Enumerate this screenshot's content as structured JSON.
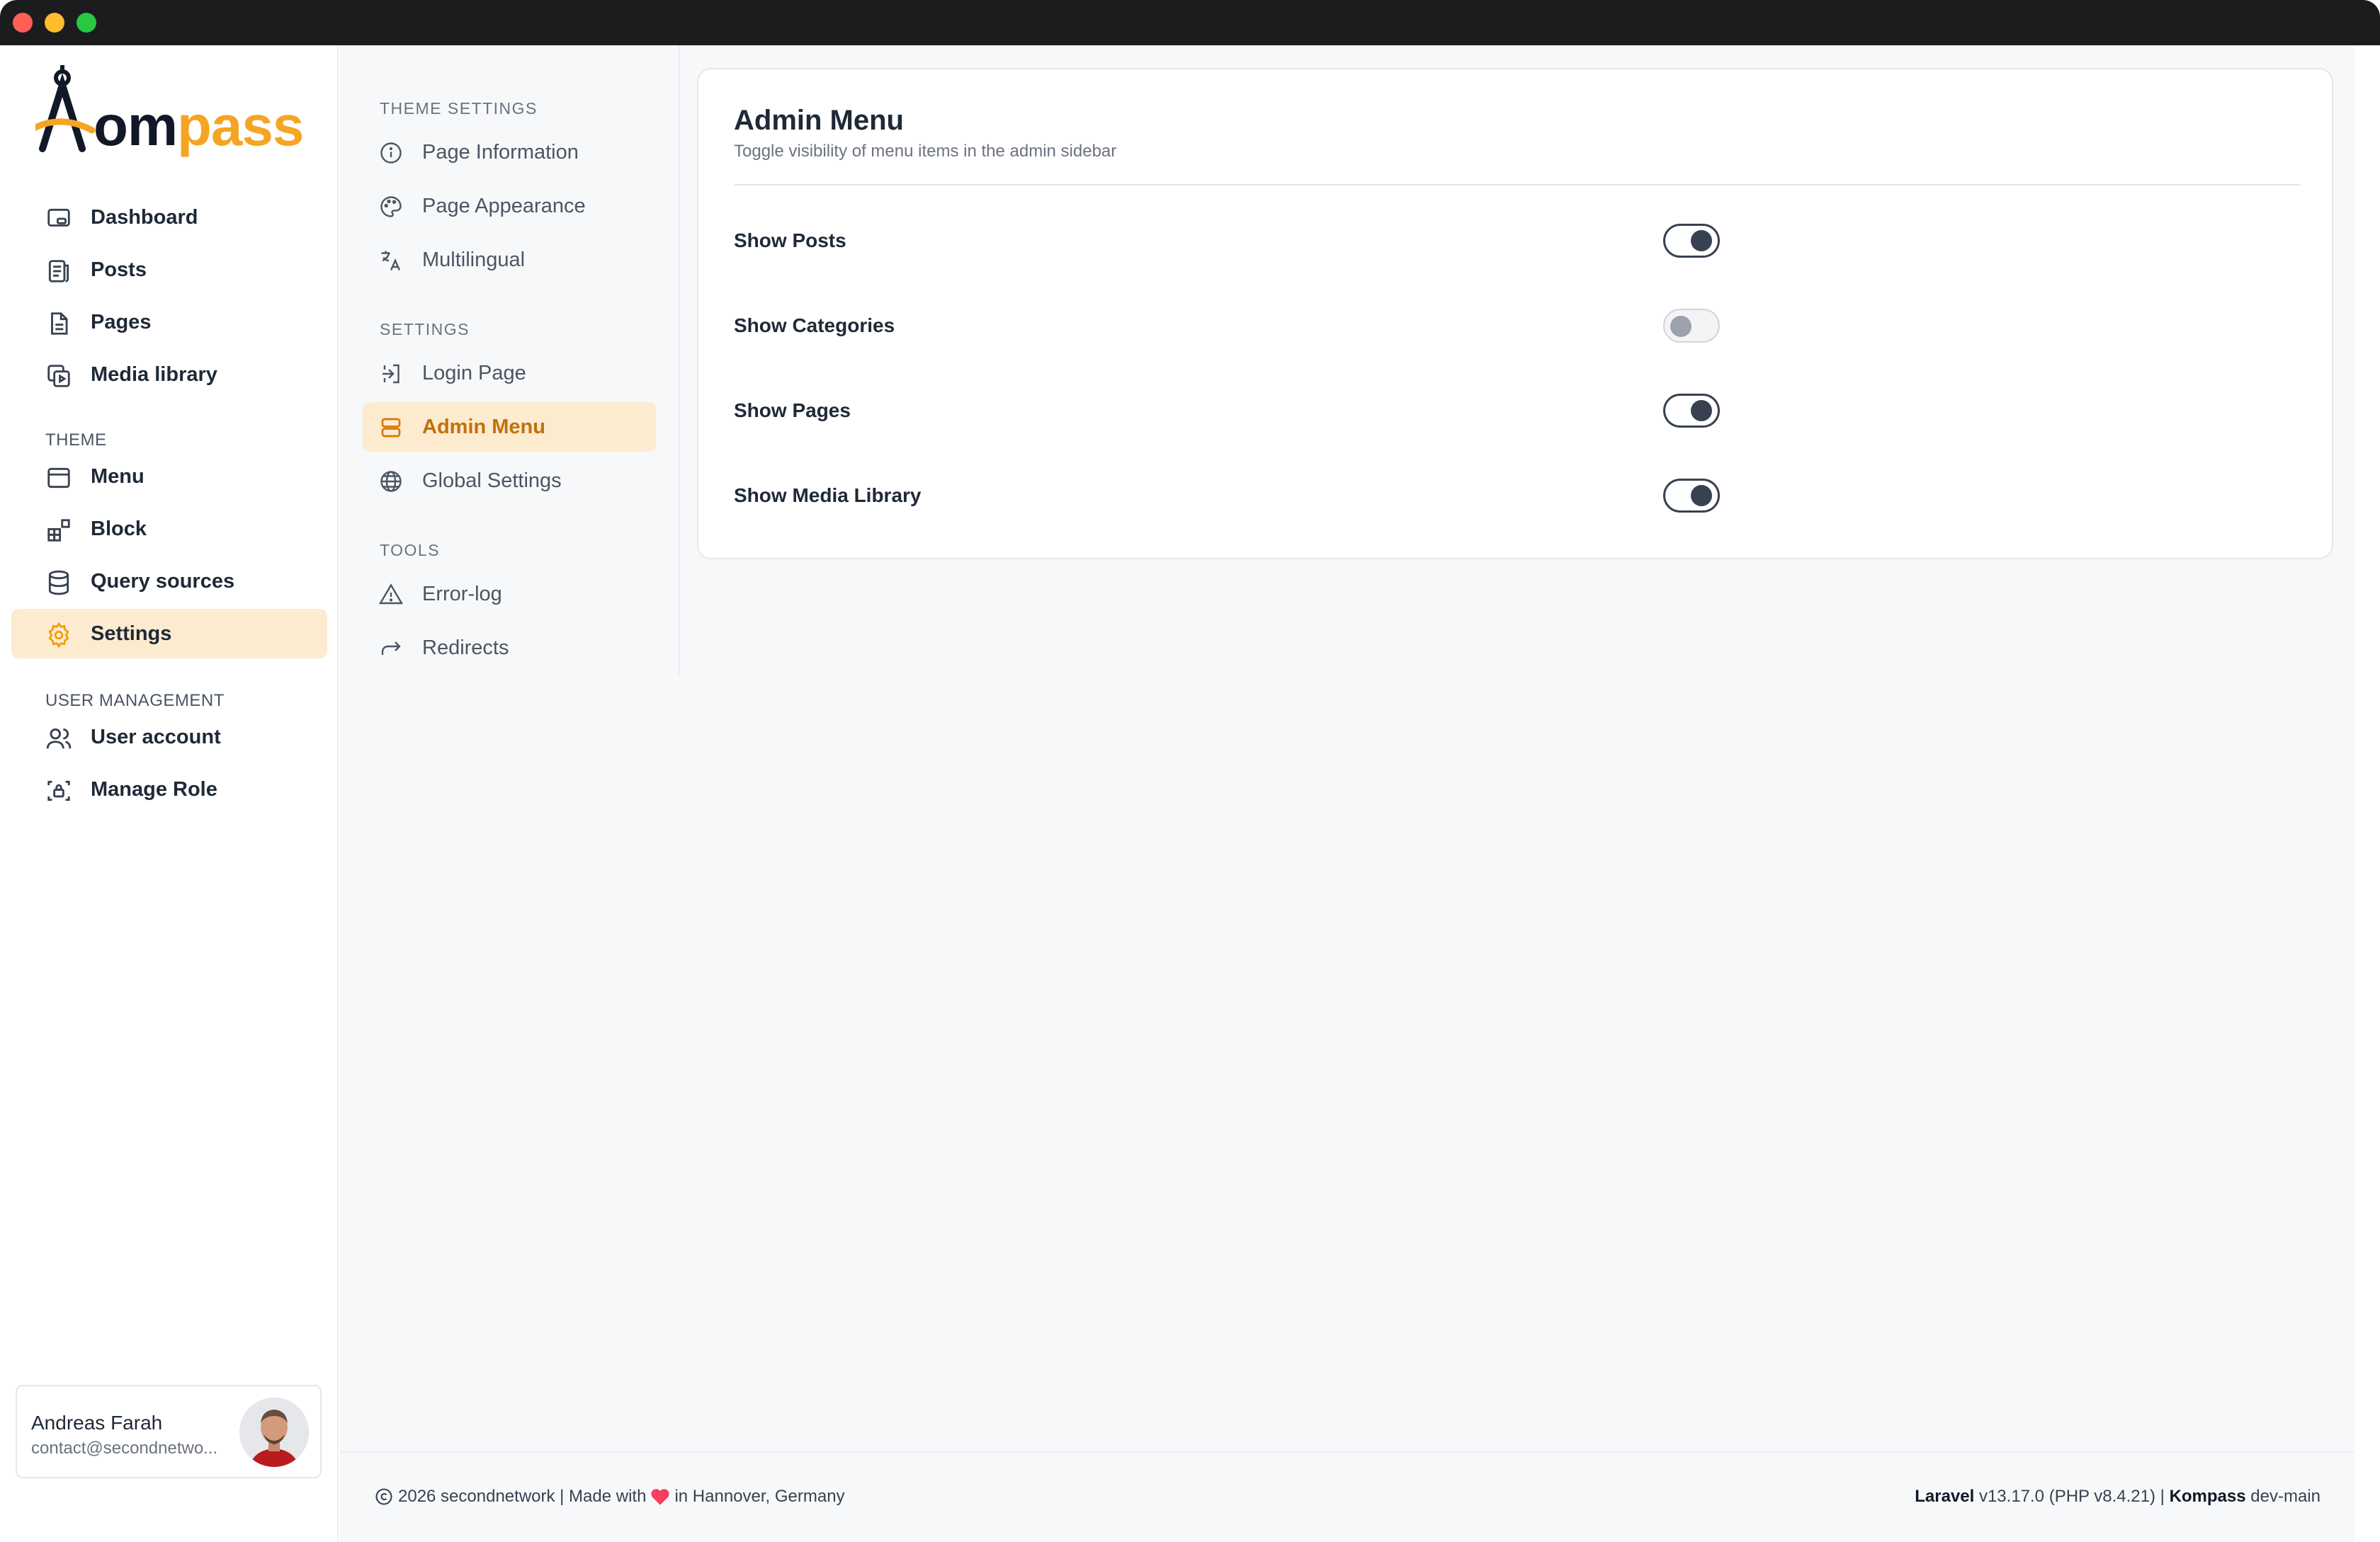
{
  "brand": {
    "logo_text_start": "om",
    "logo_text_end": "pass",
    "accent": "#f5a524"
  },
  "sidebar": {
    "items_main": [
      {
        "label": "Dashboard",
        "icon": "dashboard-icon"
      },
      {
        "label": "Posts",
        "icon": "posts-icon"
      },
      {
        "label": "Pages",
        "icon": "pages-icon"
      },
      {
        "label": "Media library",
        "icon": "media-icon"
      }
    ],
    "theme_label": "THEME",
    "items_theme": [
      {
        "label": "Menu",
        "icon": "menu-icon"
      },
      {
        "label": "Block",
        "icon": "block-icon"
      },
      {
        "label": "Query sources",
        "icon": "database-icon"
      },
      {
        "label": "Settings",
        "icon": "gear-icon",
        "active": true
      }
    ],
    "user_mgmt_label": "USER MANAGEMENT",
    "items_users": [
      {
        "label": "User account",
        "icon": "users-icon"
      },
      {
        "label": "Manage Role",
        "icon": "role-icon"
      }
    ]
  },
  "user": {
    "name": "Andreas Farah",
    "email": "contact@secondnetwo..."
  },
  "subnav": {
    "theme_settings_label": "THEME SETTINGS",
    "theme_items": [
      "Page Information",
      "Page Appearance",
      "Multilingual"
    ],
    "settings_label": "SETTINGS",
    "settings_items": [
      "Login Page",
      "Admin Menu",
      "Global Settings"
    ],
    "tools_label": "TOOLS",
    "tools_items": [
      "Error-log",
      "Redirects"
    ]
  },
  "card": {
    "title": "Admin Menu",
    "subtitle": "Toggle visibility of menu items in the admin sidebar",
    "toggles": [
      {
        "label": "Show Posts",
        "on": true
      },
      {
        "label": "Show Categories",
        "on": false
      },
      {
        "label": "Show Pages",
        "on": true
      },
      {
        "label": "Show Media Library",
        "on": true
      }
    ]
  },
  "footer": {
    "left_text_a": "2026 secondnetwork | Made with",
    "left_text_b": "in Hannover, Germany",
    "laravel_label": "Laravel",
    "laravel_version": "v13.17.0 (PHP v8.4.21) |",
    "kompass_label": "Kompass",
    "kompass_version": "dev-main"
  }
}
